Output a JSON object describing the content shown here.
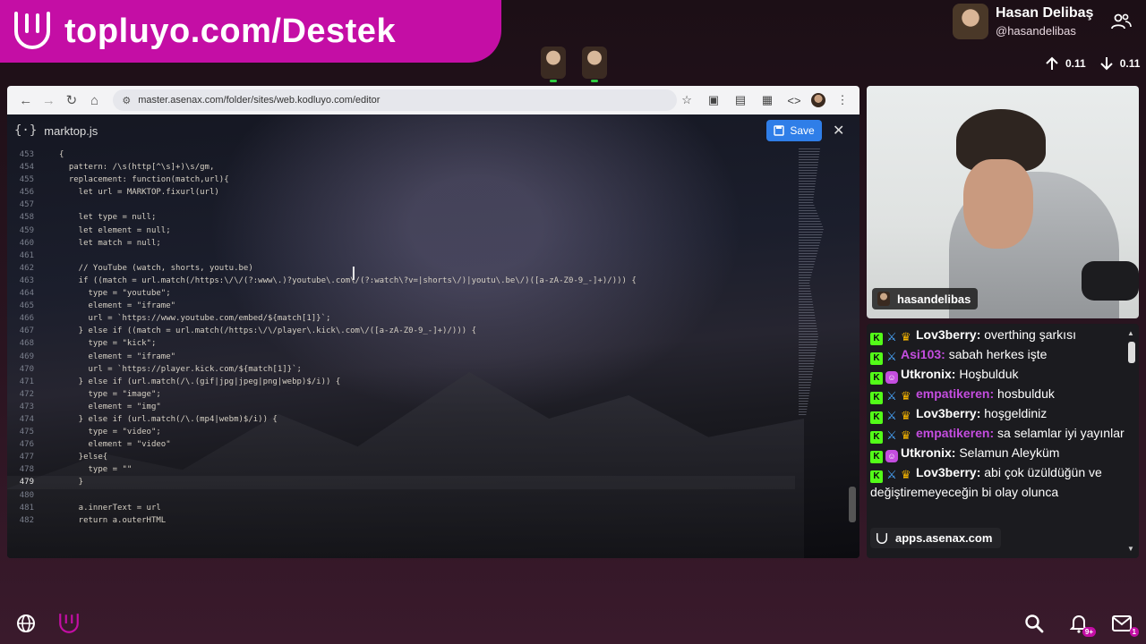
{
  "banner": {
    "text": "topluyo.com/Destek"
  },
  "profile": {
    "name": "Hasan Delibaş",
    "handle": "@hasandelibas"
  },
  "stats": {
    "up": "0.11",
    "down": "0.11"
  },
  "browser": {
    "url": "master.asenax.com/folder/sites/web.kodluyo.com/editor"
  },
  "editor": {
    "file_name": "marktop.js",
    "save_label": "Save",
    "lines": [
      {
        "n": "453",
        "t": "{"
      },
      {
        "n": "454",
        "t": "  pattern: /\\s(http[^\\s]+)\\s/gm,"
      },
      {
        "n": "455",
        "t": "  replacement: function(match,url){"
      },
      {
        "n": "456",
        "t": "    let url = MARKTOP.fixurl(url)"
      },
      {
        "n": "457",
        "t": ""
      },
      {
        "n": "458",
        "t": "    let type = null;"
      },
      {
        "n": "459",
        "t": "    let element = null;"
      },
      {
        "n": "460",
        "t": "    let match = null;"
      },
      {
        "n": "461",
        "t": ""
      },
      {
        "n": "462",
        "t": "    // YouTube (watch, shorts, youtu.be)"
      },
      {
        "n": "463",
        "t": "    if ((match = url.match(/https:\\/\\/(?:www\\.)?youtube\\.com\\/(?:watch\\?v=|shorts\\/)|youtu\\.be\\/)([a-zA-Z0-9_-]+)/))) {"
      },
      {
        "n": "464",
        "t": "      type = \"youtube\";"
      },
      {
        "n": "465",
        "t": "      element = \"iframe\""
      },
      {
        "n": "466",
        "t": "      url = `https://www.youtube.com/embed/${match[1]}`;"
      },
      {
        "n": "467",
        "t": "    } else if ((match = url.match(/https:\\/\\/player\\.kick\\.com\\/([a-zA-Z0-9_-]+)/))) {"
      },
      {
        "n": "468",
        "t": "      type = \"kick\";"
      },
      {
        "n": "469",
        "t": "      element = \"iframe\""
      },
      {
        "n": "470",
        "t": "      url = `https://player.kick.com/${match[1]}`;"
      },
      {
        "n": "471",
        "t": "    } else if (url.match(/\\.(gif|jpg|jpeg|png|webp)$/i)) {"
      },
      {
        "n": "472",
        "t": "      type = \"image\";"
      },
      {
        "n": "473",
        "t": "      element = \"img\""
      },
      {
        "n": "474",
        "t": "    } else if (url.match(/\\.(mp4|webm)$/i)) {"
      },
      {
        "n": "475",
        "t": "      type = \"video\";"
      },
      {
        "n": "476",
        "t": "      element = \"video\""
      },
      {
        "n": "477",
        "t": "    }else{"
      },
      {
        "n": "478",
        "t": "      type = \"\""
      },
      {
        "n": "479",
        "t": "    }"
      },
      {
        "n": "480",
        "t": ""
      },
      {
        "n": "481",
        "t": "    a.innerText = url"
      },
      {
        "n": "482",
        "t": "    return a.outerHTML"
      }
    ],
    "active_line": "479",
    "user_tag": "hasandelibas"
  },
  "webcam": {
    "label": "hasandelibas"
  },
  "chat": {
    "colors": {
      "purple": "#c44ddf",
      "pink": "#e25ad3",
      "white": "#ffffff"
    },
    "messages": [
      {
        "badges": [
          "kick",
          "sword",
          "crown"
        ],
        "user": "Lov3berry:",
        "color": "#ffffff",
        "text": " overthing şarkısı"
      },
      {
        "badges": [
          "kick",
          "sword"
        ],
        "user": "Asi103:",
        "color": "#c44ddf",
        "text": " sabah herkes işte"
      },
      {
        "badges": [
          "kick",
          "sub"
        ],
        "user": "Utkronix:",
        "color": "#ffffff",
        "text": " Hoşbulduk"
      },
      {
        "badges": [
          "kick",
          "sword",
          "crown"
        ],
        "user": "empatikeren:",
        "color": "#c44ddf",
        "text": " hosbulduk"
      },
      {
        "badges": [
          "kick",
          "sword",
          "crown"
        ],
        "user": "Lov3berry:",
        "color": "#ffffff",
        "text": " hoşgeldiniz"
      },
      {
        "badges": [
          "kick",
          "sword",
          "crown"
        ],
        "user": "empatikeren:",
        "color": "#c44ddf",
        "text": " sa selamlar iyi yayınlar"
      },
      {
        "badges": [
          "kick",
          "sub"
        ],
        "user": "Utkronix:",
        "color": "#ffffff",
        "text": " Selamun Aleyküm"
      },
      {
        "badges": [
          "kick",
          "sword",
          "crown"
        ],
        "user": "Lov3berry:",
        "color": "#ffffff",
        "text": " abi çok üzüldüğün ve değiştiremeyeceğin bi olay olunca"
      }
    ],
    "apps_tag": "apps.asenax.com"
  },
  "bottom": {
    "notification_badge": "9+",
    "message_badge": "1"
  }
}
